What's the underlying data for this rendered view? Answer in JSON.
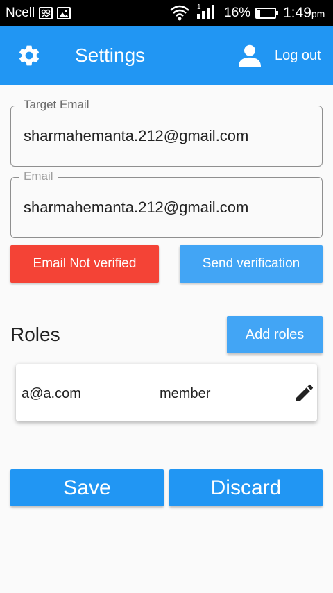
{
  "status_bar": {
    "carrier": "Ncell",
    "battery_percent": "16%",
    "battery_level": 0.16,
    "time": "1:49",
    "time_suffix": "pm",
    "icons": [
      "image-icon",
      "image-icon",
      "wifi-icon",
      "signal-icon",
      "battery-icon"
    ]
  },
  "app_bar": {
    "title": "Settings",
    "logout_label": "Log out",
    "icons": [
      "gear-icon",
      "person-icon"
    ],
    "color": "#2196f3"
  },
  "form": {
    "target_email": {
      "label": "Target Email",
      "value": "sharmahemanta.212@gmail.com"
    },
    "email": {
      "label": "Email",
      "value": "sharmahemanta.212@gmail.com"
    },
    "not_verified_label": "Email Not verified",
    "send_verification_label": "Send verification"
  },
  "roles": {
    "title": "Roles",
    "add_label": "Add roles",
    "items": [
      {
        "email": "a@a.com",
        "role": "member",
        "icon": "edit-icon"
      }
    ]
  },
  "actions": {
    "save_label": "Save",
    "discard_label": "Discard"
  },
  "colors": {
    "primary": "#2196f3",
    "secondary_button": "#42a5f5",
    "error": "#f44336",
    "background": "#fafafa"
  }
}
